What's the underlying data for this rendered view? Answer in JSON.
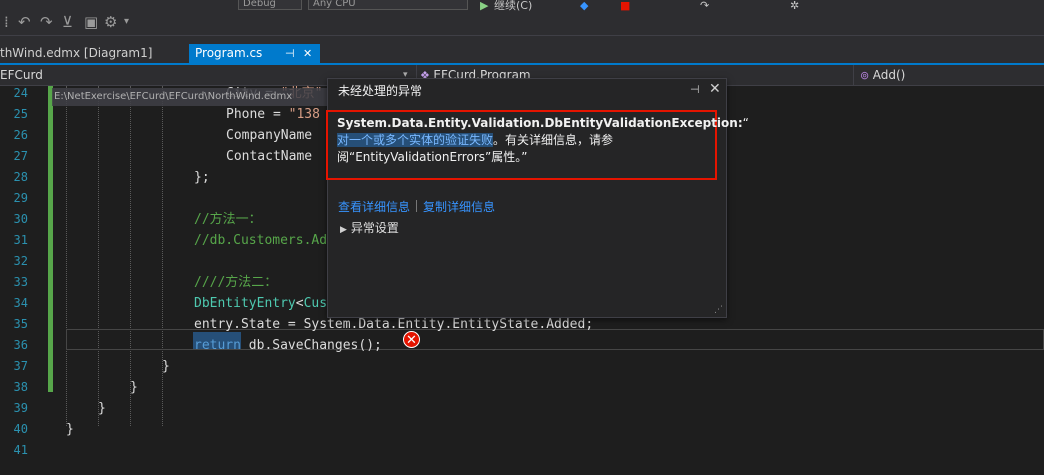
{
  "toolbar": {
    "config_value": "Debug",
    "platform_value": "Any CPU",
    "run_label": "继续(C)",
    "menu_icons": [
      "undo-icon",
      "redo-icon",
      "filter-icon",
      "save-icon",
      "gear-icon"
    ]
  },
  "tabs": [
    {
      "label": "thWind.edmx [Diagram1]",
      "active": false
    },
    {
      "label": "Program.cs",
      "active": true,
      "pin": "⊣",
      "close": "✕"
    }
  ],
  "navbar": {
    "project": "EFCurd",
    "class": "EFCurd.Program",
    "member": "Add()"
  },
  "path_overlay": "E:\\NetExercise\\EFCurd\\EFCurd\\NorthWind.edmx",
  "code": {
    "lines": [
      {
        "num": "24",
        "text": "City = \"北京\"",
        "indent": 226,
        "cls": "c-plain"
      },
      {
        "num": "25",
        "text": "Phone = \"138",
        "indent": 226,
        "cls": "c-plain"
      },
      {
        "num": "26",
        "text": "CompanyName",
        "indent": 226,
        "cls": "c-plain"
      },
      {
        "num": "27",
        "text": "ContactName",
        "indent": 226,
        "cls": "c-plain"
      },
      {
        "num": "28",
        "text": "};",
        "indent": 194,
        "cls": "c-plain"
      },
      {
        "num": "29",
        "text": "",
        "indent": 194,
        "cls": "c-plain"
      },
      {
        "num": "30",
        "text": "//方法一：",
        "indent": 194,
        "cls": "c-comment"
      },
      {
        "num": "31",
        "text": "//db.Customers.Ad",
        "indent": 194,
        "cls": "c-comment"
      },
      {
        "num": "32",
        "text": "",
        "indent": 194,
        "cls": "c-plain"
      },
      {
        "num": "33",
        "text": "////方法二：",
        "indent": 194,
        "cls": "c-comment"
      },
      {
        "num": "34",
        "text": "DbEntityEntry<Cus",
        "indent": 194,
        "cls": "c-type"
      },
      {
        "num": "35",
        "text": "entry.State = System.Data.Entity.EntityState.Added;",
        "indent": 194,
        "cls": "c-plain"
      },
      {
        "num": "36",
        "text": "return db.SaveChanges();",
        "indent": 194,
        "cls": "c-plain"
      },
      {
        "num": "37",
        "text": "}",
        "indent": 162,
        "cls": "c-plain"
      },
      {
        "num": "38",
        "text": "}",
        "indent": 130,
        "cls": "c-plain"
      },
      {
        "num": "39",
        "text": "}",
        "indent": 98,
        "cls": "c-plain"
      },
      {
        "num": "40",
        "text": "}",
        "indent": 66,
        "cls": "c-plain"
      },
      {
        "num": "41",
        "text": "",
        "indent": 66,
        "cls": "c-plain"
      }
    ]
  },
  "exception": {
    "title": "未经处理的异常",
    "type": "System.Data.Entity.Validation.DbEntityValidationException:",
    "quote_open": "“",
    "highlighted": "对一个或多个实体的验证失败",
    "rest1": "。有关详细信息，请参",
    "rest2": "阅“EntityValidationErrors”属性。”",
    "view_details": "查看详细信息",
    "copy_details": "复制详细信息",
    "settings": "异常设置"
  },
  "colors": {
    "accent": "#007acc",
    "error": "#e51400",
    "comment": "#57a64a",
    "keyword": "#569cd6",
    "type": "#4ec9b0",
    "link": "#3794ff"
  }
}
